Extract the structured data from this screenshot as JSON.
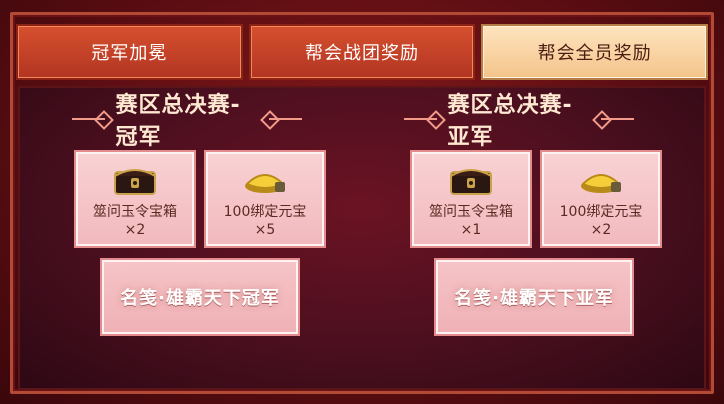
{
  "tabs": [
    {
      "label": "冠军加冕",
      "active": false
    },
    {
      "label": "帮会战团奖励",
      "active": false
    },
    {
      "label": "帮会全员奖励",
      "active": true
    }
  ],
  "sections": [
    {
      "title": "赛区总决赛-冠军",
      "rewards": [
        {
          "icon": "treasure-chest-icon",
          "name": "筮问玉令宝箱",
          "qty": "×2"
        },
        {
          "icon": "gold-ingot-icon",
          "name": "100绑定元宝",
          "qty": "×5"
        }
      ],
      "title_reward": "名笺·雄霸天下冠军"
    },
    {
      "title": "赛区总决赛-亚军",
      "rewards": [
        {
          "icon": "treasure-chest-icon",
          "name": "筮问玉令宝箱",
          "qty": "×1"
        },
        {
          "icon": "gold-ingot-icon",
          "name": "100绑定元宝",
          "qty": "×2"
        }
      ],
      "title_reward": "名笺·雄霸天下亚军"
    }
  ],
  "colors": {
    "frame_red": "#8a1a1c",
    "tab_red": "#d6502e",
    "tab_active": "#ffe4bf",
    "item_pink": "#f8d2d4",
    "title_text": "#ffe8d1"
  }
}
